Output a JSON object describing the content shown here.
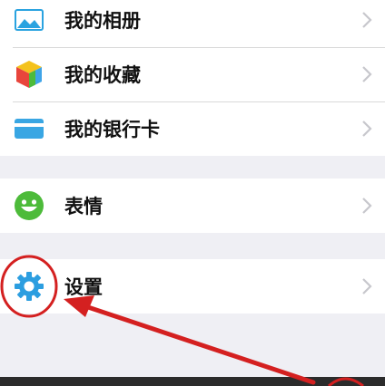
{
  "menu": {
    "group1": [
      {
        "label": "我的相册",
        "icon": "photo-album-icon"
      },
      {
        "label": "我的收藏",
        "icon": "favorites-cube-icon"
      },
      {
        "label": "我的银行卡",
        "icon": "bank-card-icon"
      }
    ],
    "group2": [
      {
        "label": "表情",
        "icon": "smiley-icon"
      }
    ],
    "group3": [
      {
        "label": "设置",
        "icon": "gear-icon"
      }
    ]
  },
  "colors": {
    "background": "#efeff4",
    "row_background": "#ffffff",
    "chevron": "#c7c7cc",
    "annotation_red": "#d42020",
    "album_blue": "#2aa3e0",
    "card_blue": "#39a6e3",
    "smiley_green": "#4dbb3a",
    "gear_blue": "#2c9ee0"
  }
}
